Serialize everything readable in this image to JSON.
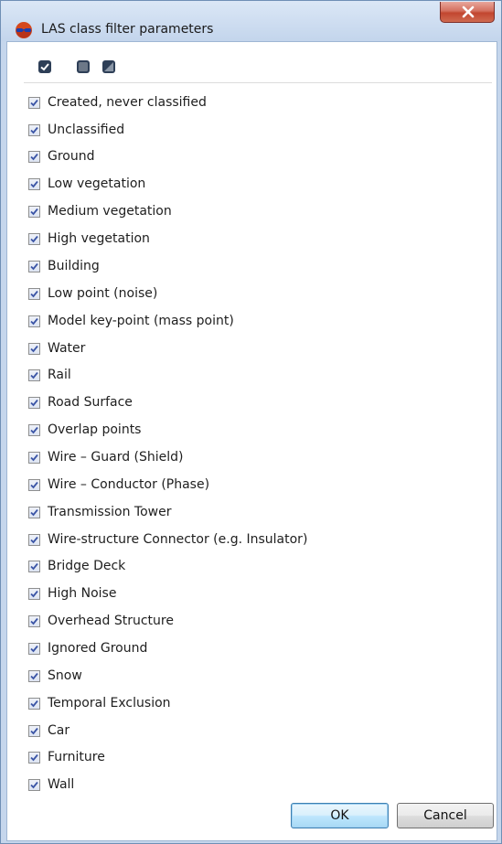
{
  "window": {
    "title": "LAS class filter parameters",
    "close_label": "x"
  },
  "toolbar": {
    "check_all": "check-all-icon",
    "uncheck_all": "uncheck-all-icon",
    "invert": "invert-selection-icon"
  },
  "classes": [
    {
      "label": "Created, never classified",
      "checked": true
    },
    {
      "label": "Unclassified",
      "checked": true
    },
    {
      "label": "Ground",
      "checked": true
    },
    {
      "label": "Low vegetation",
      "checked": true
    },
    {
      "label": "Medium vegetation",
      "checked": true
    },
    {
      "label": "High vegetation",
      "checked": true
    },
    {
      "label": "Building",
      "checked": true
    },
    {
      "label": "Low point (noise)",
      "checked": true
    },
    {
      "label": "Model key-point (mass point)",
      "checked": true
    },
    {
      "label": "Water",
      "checked": true
    },
    {
      "label": "Rail",
      "checked": true
    },
    {
      "label": "Road Surface",
      "checked": true
    },
    {
      "label": "Overlap points",
      "checked": true
    },
    {
      "label": "Wire – Guard (Shield)",
      "checked": true
    },
    {
      "label": "Wire – Conductor (Phase)",
      "checked": true
    },
    {
      "label": "Transmission Tower",
      "checked": true
    },
    {
      "label": "Wire-structure Connector (e.g. Insulator)",
      "checked": true
    },
    {
      "label": "Bridge Deck",
      "checked": true
    },
    {
      "label": "High Noise",
      "checked": true
    },
    {
      "label": "Overhead Structure",
      "checked": true
    },
    {
      "label": "Ignored Ground",
      "checked": true
    },
    {
      "label": "Snow",
      "checked": true
    },
    {
      "label": "Temporal Exclusion",
      "checked": true
    },
    {
      "label": "Car",
      "checked": true
    },
    {
      "label": "Furniture",
      "checked": true
    },
    {
      "label": "Wall",
      "checked": true
    }
  ],
  "buttons": {
    "ok": "OK",
    "cancel": "Cancel"
  }
}
